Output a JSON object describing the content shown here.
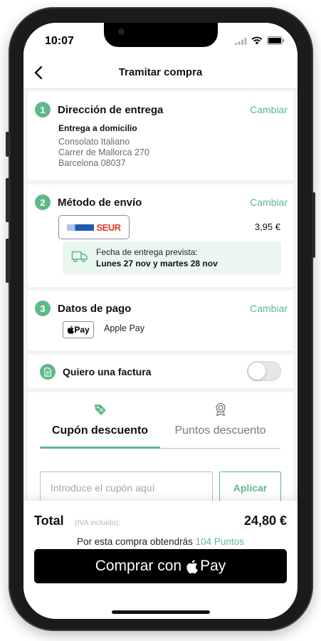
{
  "status": {
    "time": "10:07"
  },
  "nav": {
    "title": "Tramitar compra"
  },
  "sections": {
    "delivery": {
      "number": "1",
      "title": "Dirección de entrega",
      "change": "Cambiar",
      "type": "Entrega a domicilio",
      "address": [
        "Consolato Italiano",
        "Carrer de Mallorca 270",
        "Barcelona 08037"
      ]
    },
    "shipping": {
      "number": "2",
      "title": "Método de envío",
      "change": "Cambiar",
      "carrier": "SEUR",
      "price": "3,95 €",
      "eta_label": "Fecha de entrega prevista:",
      "eta_value": "Lunes 27 nov y martes 28 nov"
    },
    "payment": {
      "number": "3",
      "title": "Datos de pago",
      "change": "Cambiar",
      "badge": "Pay",
      "method": "Apple Pay"
    }
  },
  "invoice": {
    "label": "Quiero una factura",
    "enabled": false
  },
  "discount_tabs": [
    {
      "label": "Cupón descuento",
      "icon": "tag-percent-icon",
      "active": true
    },
    {
      "label": "Puntos descuento",
      "icon": "award-icon",
      "active": false
    }
  ],
  "coupon": {
    "placeholder": "Introduce el cupón aquí",
    "value": "",
    "apply_label": "Aplicar"
  },
  "footer": {
    "total_label": "Total",
    "iva_note": "(IVA incluido):",
    "total_value": "24,80 €",
    "points_prefix": "Por esta compra obtendrás",
    "points_value": "104 Puntos",
    "buy_prefix": "Comprar con",
    "buy_suffix": "Pay"
  },
  "colors": {
    "accent": "#5fb88a",
    "eta_background": "#eaf7f0",
    "page_background": "#f3f3f4"
  }
}
